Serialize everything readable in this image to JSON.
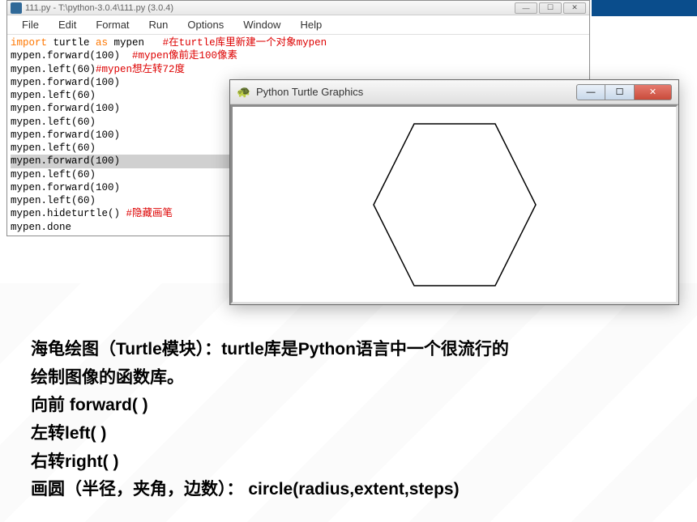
{
  "idle": {
    "title": "111.py - T:\\python-3.0.4\\111.py (3.0.4)",
    "menu": [
      "File",
      "Edit",
      "Format",
      "Run",
      "Options",
      "Window",
      "Help"
    ],
    "code": {
      "line1_kw1": "import",
      "line1_mod": " turtle ",
      "line1_kw2": "as",
      "line1_alias": " mypen   ",
      "line1_comment": "#在turtle库里新建一个对象mypen",
      "line2_code": "mypen.forward(100)  ",
      "line2_comment": "#mypen像前走100像素",
      "line3_code": "mypen.left(60)",
      "line3_comment": "#mypen想左转72度",
      "line4": "mypen.forward(100)",
      "line5": "mypen.left(60)",
      "line6": "mypen.forward(100)",
      "line7": "mypen.left(60)",
      "line8": "mypen.forward(100)",
      "line9": "mypen.left(60)",
      "line10": "mypen.forward(100)",
      "line11": "mypen.left(60)",
      "line12": "mypen.forward(100)",
      "line13": "mypen.left(60)",
      "line14_code": "mypen.hideturtle() ",
      "line14_comment": "#隐藏画笔",
      "line15": "mypen.done"
    },
    "win_min": "—",
    "win_max": "☐",
    "win_close": "✕"
  },
  "turtle": {
    "title": "Python Turtle Graphics",
    "icon": "🐢",
    "min": "—",
    "max": "☐",
    "close": "✕"
  },
  "explain": {
    "line1": "海龟绘图（Turtle模块）：turtle库是Python语言中一个很流行的绘制图像的函数库。",
    "line2": "向前 forward( )",
    "line3": "左转left( )",
    "line4": "右转right( )",
    "line5": "画圆（半径，夹角，边数）： circle(radius,extent,steps)"
  }
}
